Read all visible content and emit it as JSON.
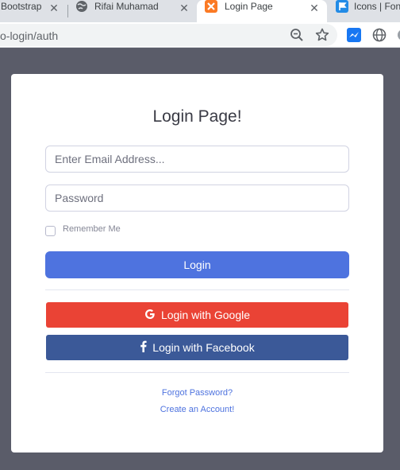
{
  "browser": {
    "tabs": [
      {
        "label": "Bootstrap",
        "active": false
      },
      {
        "label": "Rifai Muhamad",
        "active": false
      },
      {
        "label": "Login Page",
        "active": true
      },
      {
        "label": "Icons | Font",
        "active": false
      }
    ],
    "close_glyph": "✕",
    "url": "o-login/auth"
  },
  "login": {
    "title": "Login Page!",
    "email_placeholder": "Enter Email Address...",
    "password_placeholder": "Password",
    "remember_label": "Remember Me",
    "remember_checked": false,
    "login_button": "Login",
    "google_button": "Login with Google",
    "facebook_button": "Login with Facebook",
    "forgot_link": "Forgot Password?",
    "create_link": "Create an Account!"
  },
  "colors": {
    "background": "#5a5c69",
    "primary": "#4e73df",
    "google": "#ea4335",
    "facebook": "#3b5998"
  }
}
